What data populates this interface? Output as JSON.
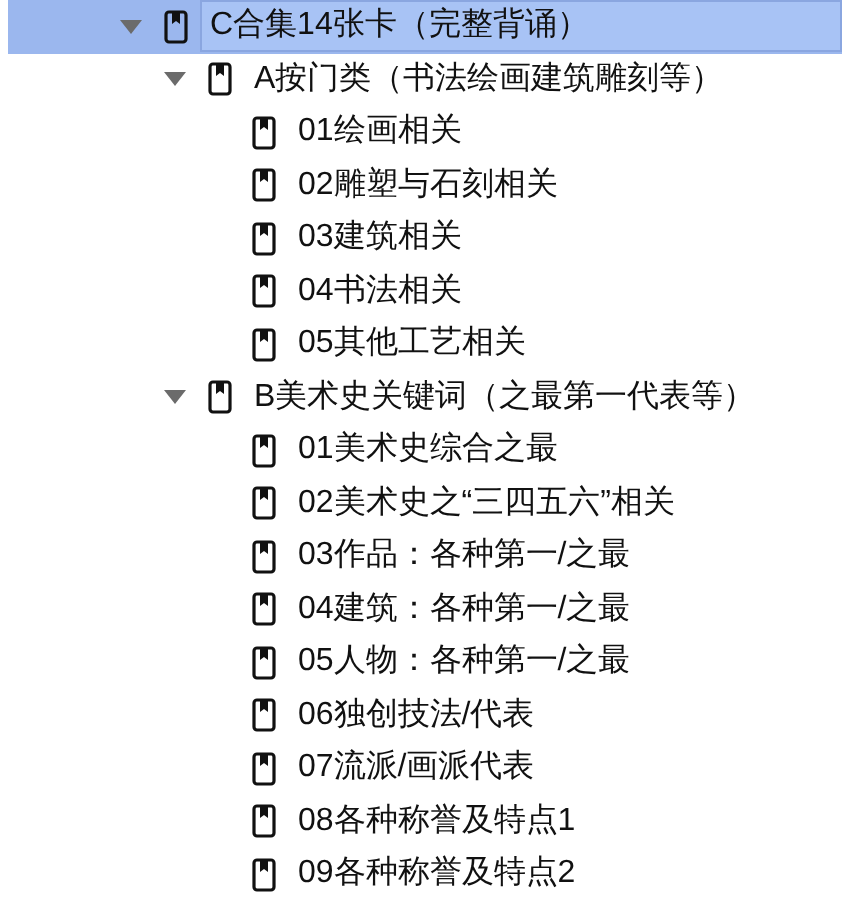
{
  "tree": [
    {
      "label": "C合集14张卡（完整背诵）",
      "selected": true,
      "expanded": true,
      "children": [
        {
          "label": "A按门类（书法绘画建筑雕刻等）",
          "selected": false,
          "expanded": true,
          "children": [
            {
              "label": "01绘画相关",
              "selected": false
            },
            {
              "label": "02雕塑与石刻相关",
              "selected": false
            },
            {
              "label": "03建筑相关",
              "selected": false
            },
            {
              "label": "04书法相关",
              "selected": false
            },
            {
              "label": "05其他工艺相关",
              "selected": false
            }
          ]
        },
        {
          "label": "B美术史关键词（之最第一代表等）",
          "selected": false,
          "expanded": true,
          "children": [
            {
              "label": "01美术史综合之最",
              "selected": false
            },
            {
              "label": "02美术史之“三四五六”相关",
              "selected": false
            },
            {
              "label": "03作品：各种第一/之最",
              "selected": false
            },
            {
              "label": "04建筑：各种第一/之最",
              "selected": false
            },
            {
              "label": "05人物：各种第一/之最",
              "selected": false
            },
            {
              "label": "06独创技法/代表",
              "selected": false
            },
            {
              "label": "07流派/画派代表",
              "selected": false
            },
            {
              "label": "08各种称誉及特点1",
              "selected": false
            },
            {
              "label": "09各种称誉及特点2",
              "selected": false
            }
          ]
        }
      ]
    }
  ]
}
